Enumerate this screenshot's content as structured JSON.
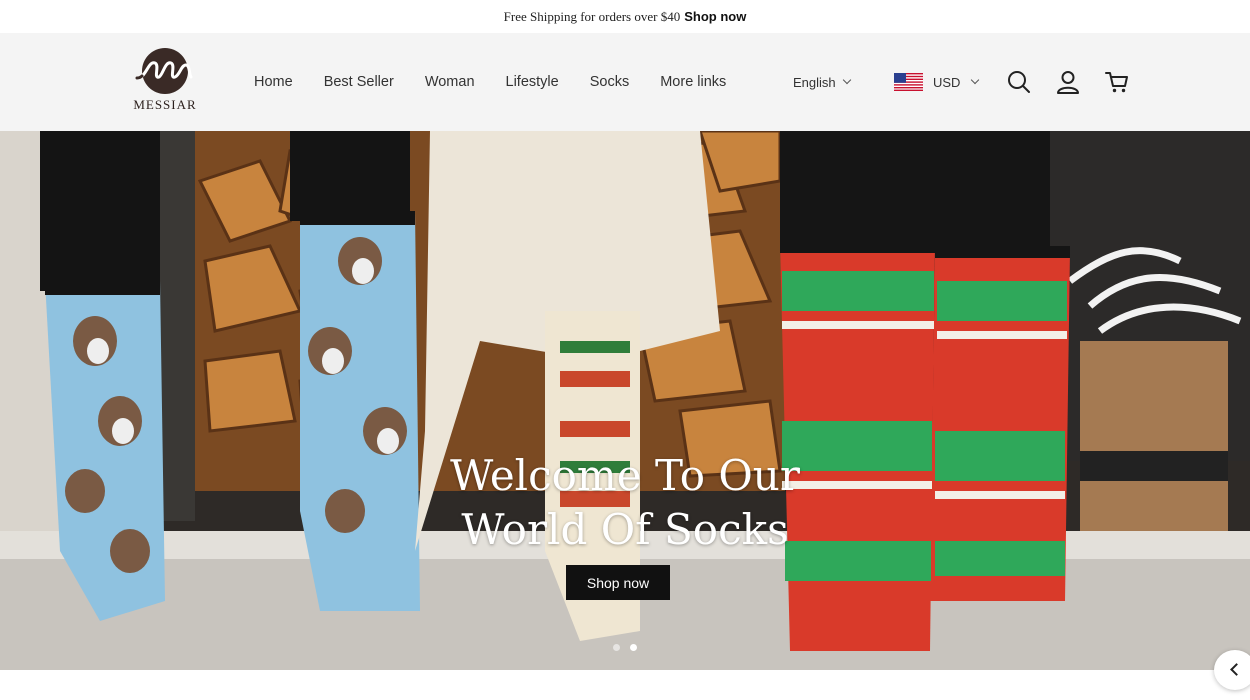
{
  "announcement": {
    "text": "Free Shipping for orders over $40",
    "link_label": "Shop now"
  },
  "header": {
    "brand": "MESSIAR",
    "nav": [
      {
        "label": "Home"
      },
      {
        "label": "Best Seller"
      },
      {
        "label": "Woman"
      },
      {
        "label": "Lifestyle"
      },
      {
        "label": "Socks"
      },
      {
        "label": "More links"
      }
    ],
    "language": "English",
    "currency": "USD",
    "icons": [
      "search-icon",
      "account-icon",
      "cart-icon",
      "chevron-down-icon",
      "us-flag-icon"
    ]
  },
  "hero": {
    "title_line1": "Welcome To Our",
    "title_line2": "World Of Socks",
    "cta_label": "Shop now",
    "slide_count": 2,
    "active_slide": 2
  },
  "colors": {
    "header_bg": "#f4f4f4",
    "button_bg": "#111111",
    "logo": "#3a2a26"
  }
}
